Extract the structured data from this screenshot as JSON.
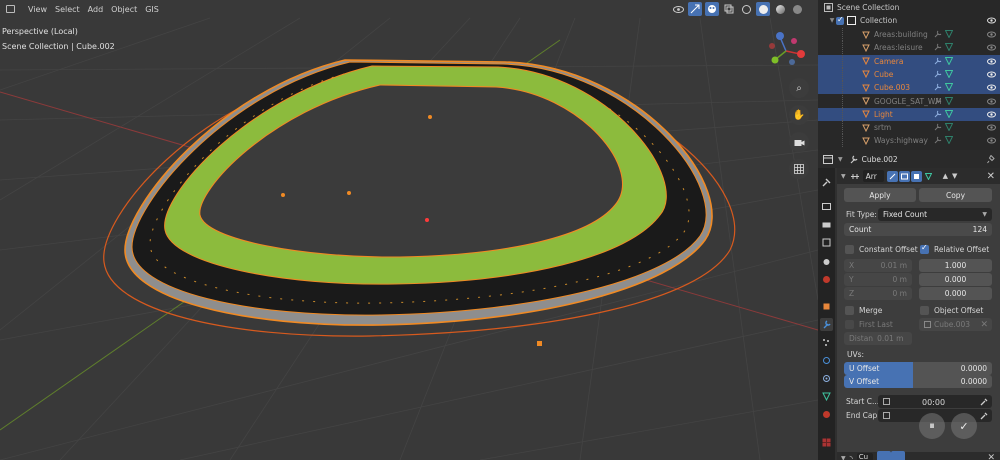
{
  "header": {
    "menu": [
      "View",
      "Select",
      "Add",
      "Object",
      "GIS"
    ]
  },
  "viewport": {
    "perspective_label": "Perspective (Local)",
    "collection_label": "Scene Collection | Cube.002"
  },
  "outliner": {
    "root": "Scene Collection",
    "collection": "Collection",
    "items": [
      {
        "label": "Areas:building",
        "selected": false,
        "color": "#808080"
      },
      {
        "label": "Areas:leisure",
        "selected": false,
        "color": "#808080"
      },
      {
        "label": "Camera",
        "selected": true,
        "color": "#e8873b"
      },
      {
        "label": "Cube",
        "selected": true,
        "color": "#e8873b"
      },
      {
        "label": "Cube.003",
        "selected": true,
        "color": "#e8873b"
      },
      {
        "label": "GOOGLE_SAT_WM",
        "selected": false,
        "color": "#808080"
      },
      {
        "label": "Light",
        "selected": true,
        "color": "#e8873b"
      },
      {
        "label": "srtm",
        "selected": false,
        "color": "#808080"
      },
      {
        "label": "Ways:highway",
        "selected": false,
        "color": "#808080"
      }
    ]
  },
  "properties": {
    "object_name": "Cube.002",
    "modifier_name": "Arr",
    "apply_label": "Apply",
    "copy_label": "Copy",
    "fit_type_label": "Fit Type:",
    "fit_type_value": "Fixed Count",
    "count_label": "Count",
    "count_value": "124",
    "constant_offset_label": "Constant Offset",
    "relative_offset_label": "Relative Offset",
    "constant": {
      "x_label": "X",
      "x": "0.01 m",
      "y_label": "Y",
      "y": "0 m",
      "z_label": "Z",
      "z": "0 m"
    },
    "relative": {
      "x": "1.000",
      "y": "0.000",
      "z": "0.000"
    },
    "merge_label": "Merge",
    "object_offset_label": "Object Offset",
    "first_last_label": "First Last",
    "object_offset_value": "Cube.003",
    "distance_label": "Distan",
    "distance_value": "0.01 m",
    "uvs_label": "UVs:",
    "u_offset_label": "U Offset",
    "u_offset_value": "0.0000",
    "v_offset_label": "V Offset",
    "v_offset_value": "0.0000",
    "start_cap_label": "Start C...",
    "end_cap_label": "End Cap",
    "next_modifier": "Cu"
  },
  "overlay": {
    "timer": "00:00",
    "pause_glyph": "⏸",
    "confirm_glyph": "✓"
  },
  "colors": {
    "grass": "#8fbe3f",
    "asphalt": "#1c1c1c",
    "curb": "#8c8c8c",
    "selection": "#f08a24",
    "accent": "#4772b3"
  }
}
